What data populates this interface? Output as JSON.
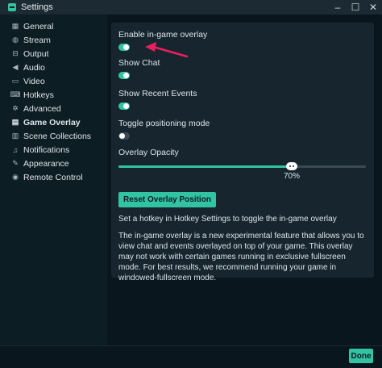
{
  "window": {
    "title": "Settings",
    "controls": [
      "–",
      "☐",
      "✕"
    ]
  },
  "sidebar": {
    "items": [
      {
        "label": "General",
        "icon": "grid-icon",
        "glyph": "▦"
      },
      {
        "label": "Stream",
        "icon": "globe-icon",
        "glyph": "◍"
      },
      {
        "label": "Output",
        "icon": "output-icon",
        "glyph": "⊟"
      },
      {
        "label": "Audio",
        "icon": "speaker-icon",
        "glyph": "◀"
      },
      {
        "label": "Video",
        "icon": "display-icon",
        "glyph": "▭"
      },
      {
        "label": "Hotkeys",
        "icon": "keyboard-icon",
        "glyph": "⌨"
      },
      {
        "label": "Advanced",
        "icon": "cogs-icon",
        "glyph": "✲"
      },
      {
        "label": "Game Overlay",
        "icon": "overlay-icon",
        "glyph": "▤",
        "active": true
      },
      {
        "label": "Scene Collections",
        "icon": "collections-icon",
        "glyph": "▥"
      },
      {
        "label": "Notifications",
        "icon": "bell-icon",
        "glyph": "♫"
      },
      {
        "label": "Appearance",
        "icon": "brush-icon",
        "glyph": "✎"
      },
      {
        "label": "Remote Control",
        "icon": "remote-icon",
        "glyph": "◉"
      }
    ]
  },
  "overlay": {
    "enable_label": "Enable in-game overlay",
    "enable_on": true,
    "show_chat_label": "Show Chat",
    "show_chat_on": true,
    "show_events_label": "Show Recent Events",
    "show_events_on": true,
    "positioning_label": "Toggle positioning mode",
    "positioning_on": false,
    "opacity_label": "Overlay Opacity",
    "opacity_value": 70,
    "opacity_display": "70%",
    "reset_label": "Reset Overlay Position",
    "hint": "Set a hotkey in Hotkey Settings to toggle the in-game overlay",
    "description": "The in-game overlay is a new experimental feature that allows you to view chat and events overlayed on top of your game. This overlay may not work with certain games running in exclusive fullscreen mode. For best results, we recommend running your game in windowed-fullscreen mode."
  },
  "footer": {
    "done_label": "Done"
  },
  "colors": {
    "accent": "#31c3a2",
    "annotation_arrow": "#ea1f5e",
    "background": "#09161d",
    "panel": "#17262e"
  }
}
